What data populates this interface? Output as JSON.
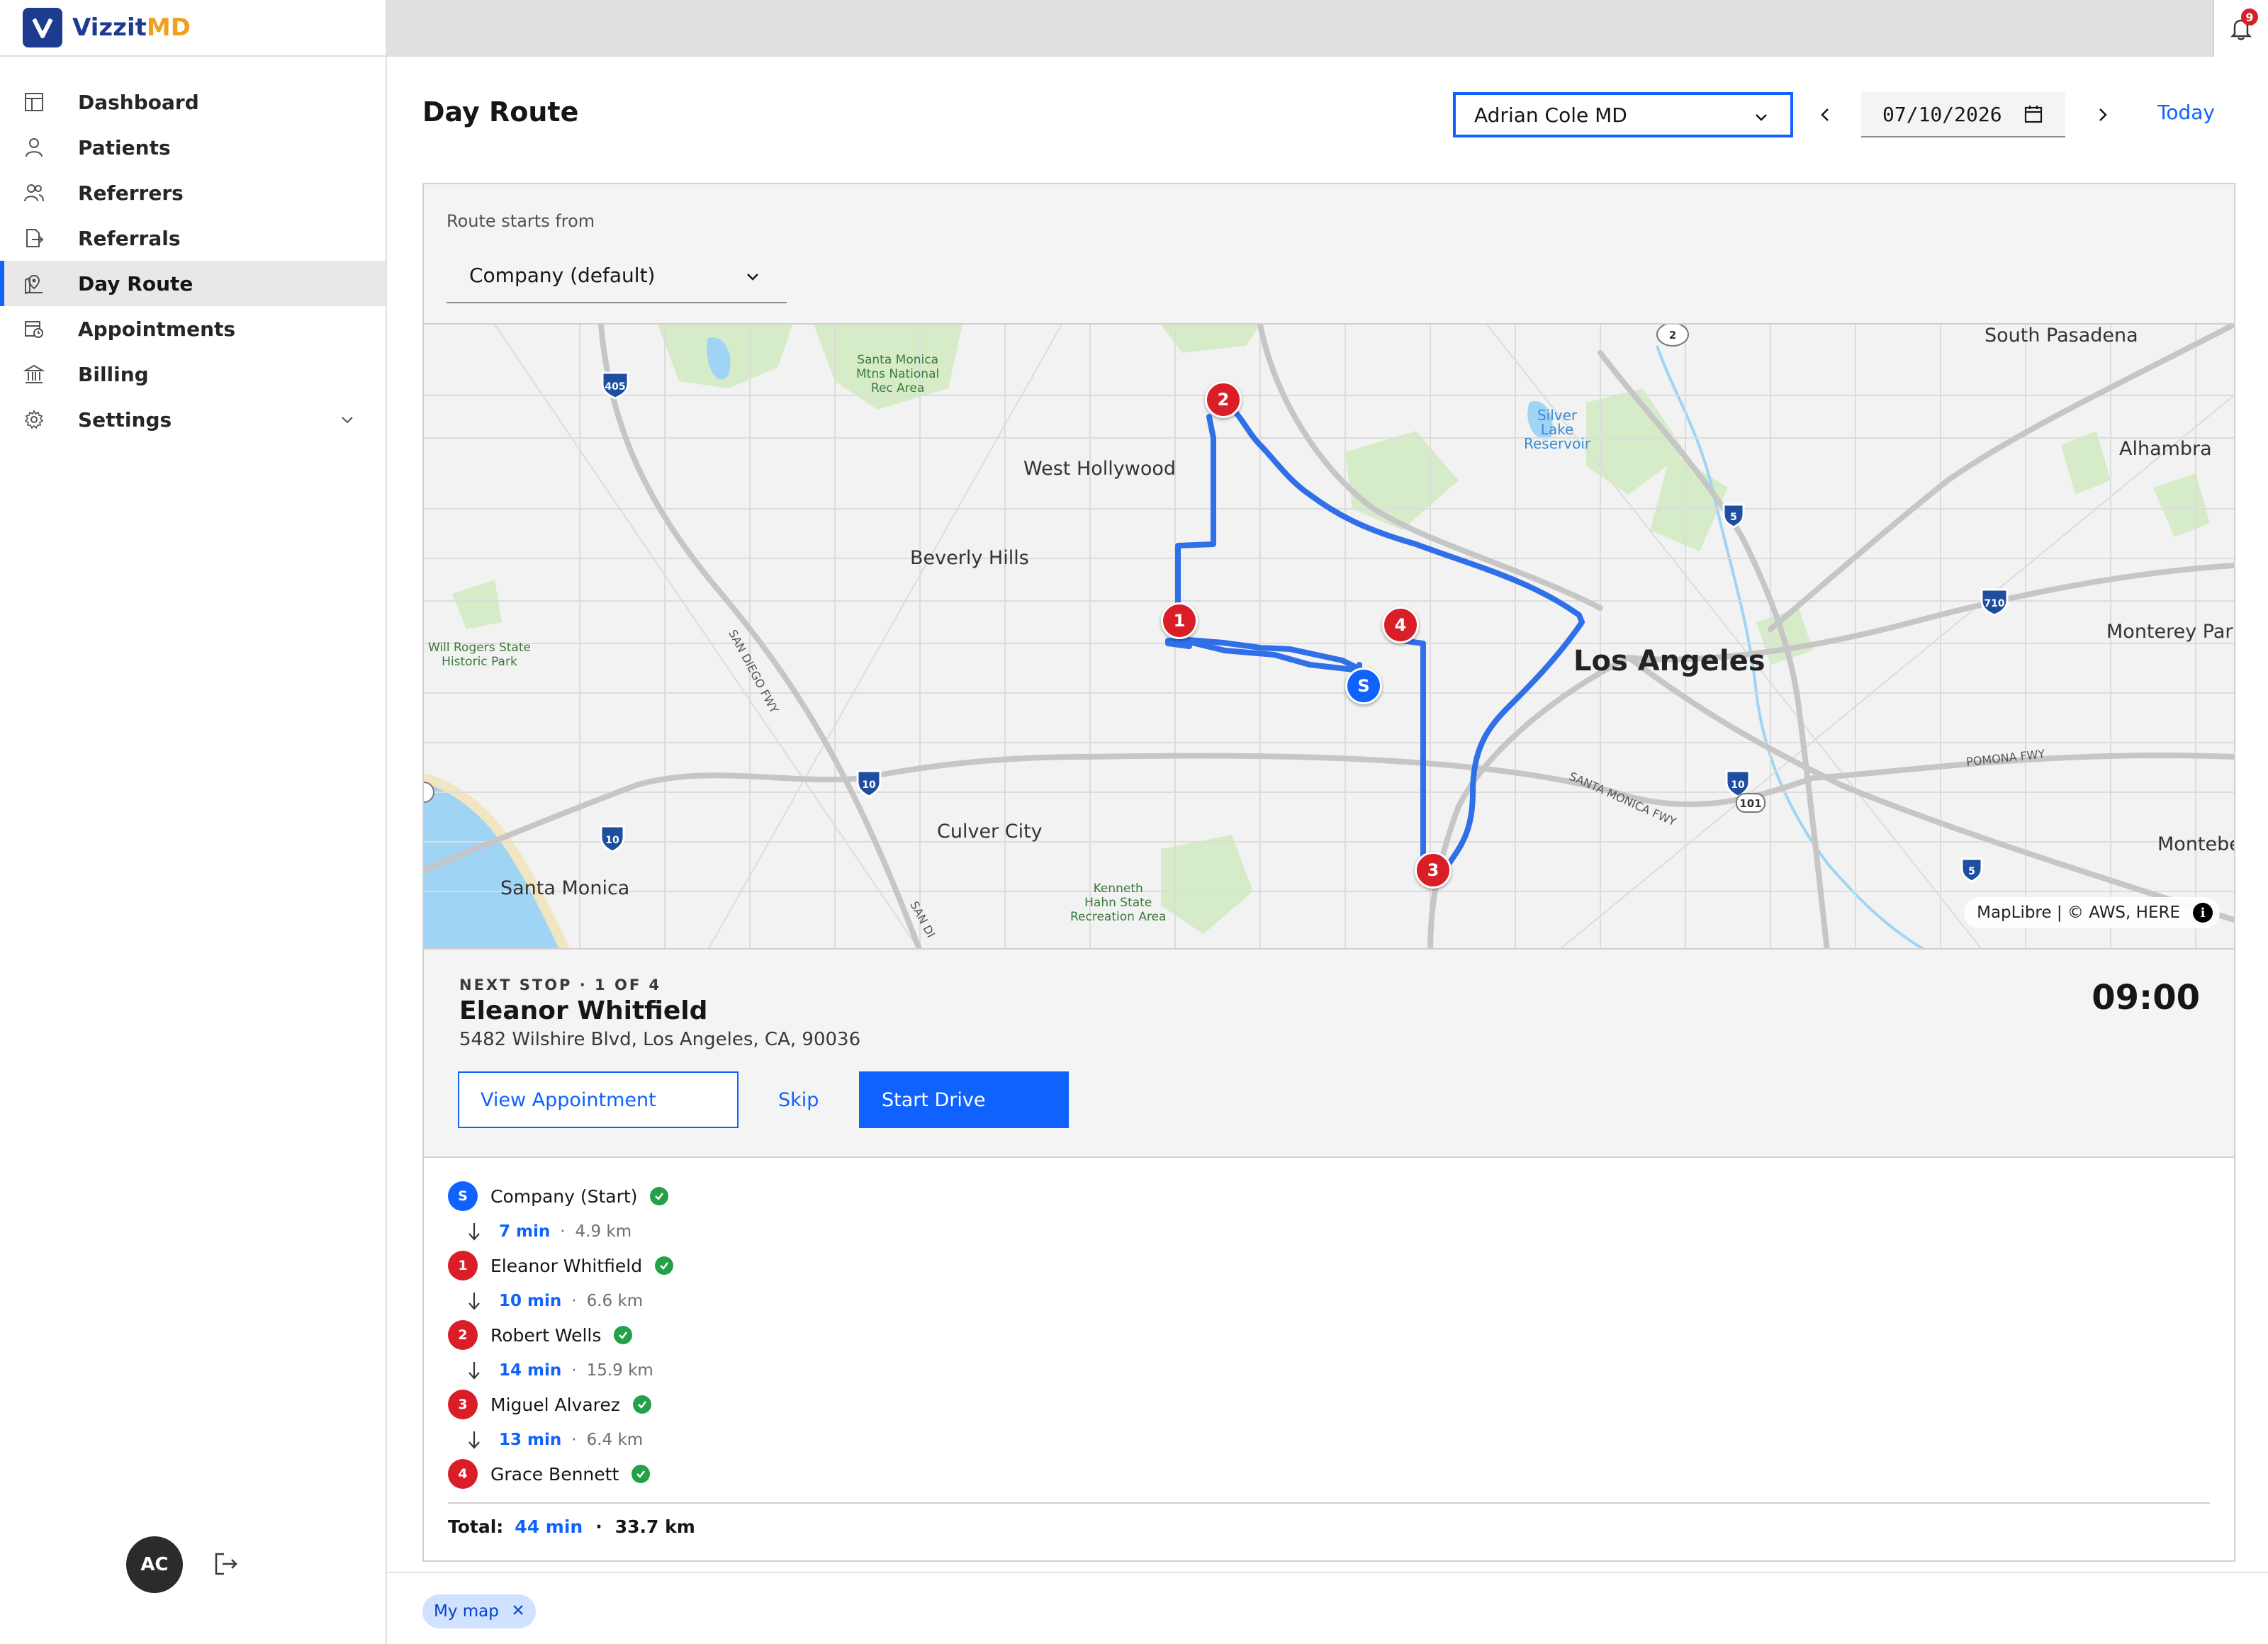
{
  "brand": {
    "name_a": "Vizzit",
    "name_b": "MD"
  },
  "notifications": {
    "count": "9"
  },
  "sidebar": {
    "items": [
      {
        "label": "Dashboard",
        "icon": "dashboard-icon"
      },
      {
        "label": "Patients",
        "icon": "user-icon"
      },
      {
        "label": "Referrers",
        "icon": "users-icon"
      },
      {
        "label": "Referrals",
        "icon": "document-export-icon"
      },
      {
        "label": "Day Route",
        "icon": "map-pin-icon",
        "active": true
      },
      {
        "label": "Appointments",
        "icon": "calendar-clock-icon"
      },
      {
        "label": "Billing",
        "icon": "bank-icon"
      },
      {
        "label": "Settings",
        "icon": "gear-icon"
      }
    ],
    "user_initials": "AC"
  },
  "header": {
    "title": "Day Route",
    "doctor": "Adrian Cole MD",
    "date": "07/10/2026",
    "today_label": "Today"
  },
  "route": {
    "starts_from_label": "Route starts from",
    "starts_from_value": "Company (default)"
  },
  "map": {
    "labels": {
      "south_pasadena": "South Pasadena",
      "alhambra": "Alhambra",
      "monterey_park": "Monterey Park",
      "montebello": "Montebe",
      "west_hollywood": "West Hollywood",
      "beverly_hills": "Beverly Hills",
      "los_angeles": "Los Angeles",
      "culver_city": "Culver City",
      "santa_monica": "Santa Monica",
      "santa_monica_mtns": "Santa Monica\nMtns National\nRec Area",
      "will_rogers": "Will Rogers State\nHistoric Park",
      "kenneth_hahn": "Kenneth\nHahn State\nRecreation Area",
      "silver_lake": "Silver\nLake\nReservoir",
      "san_diego_fwy": "SAN DIEGO FWY",
      "santa_monica_fwy": "SANTA MONICA FWY",
      "pomona_fwy": "POMONA FWY",
      "san_d2": "SAN DI"
    },
    "shields": [
      "405",
      "10",
      "10",
      "10",
      "5",
      "5",
      "710",
      "101",
      "2"
    ],
    "pins": [
      {
        "label": "S",
        "kind": "start"
      },
      {
        "label": "1",
        "kind": "stop"
      },
      {
        "label": "2",
        "kind": "stop"
      },
      {
        "label": "3",
        "kind": "stop"
      },
      {
        "label": "4",
        "kind": "stop"
      }
    ],
    "attribution": "MapLibre | © AWS, HERE",
    "route_color": "#2f6fe8"
  },
  "next_stop": {
    "kicker": "NEXT STOP · 1 OF 4",
    "name": "Eleanor Whitfield",
    "address": "5482 Wilshire Blvd, Los Angeles, CA, 90036",
    "time": "09:00",
    "view_label": "View Appointment",
    "skip_label": "Skip",
    "start_label": "Start Drive"
  },
  "stops": [
    {
      "badge": "S",
      "name": "Company (Start)"
    },
    {
      "badge": "1",
      "name": "Eleanor Whitfield"
    },
    {
      "badge": "2",
      "name": "Robert Wells"
    },
    {
      "badge": "3",
      "name": "Miguel Alvarez"
    },
    {
      "badge": "4",
      "name": "Grace Bennett"
    }
  ],
  "legs": [
    {
      "min": "7 min",
      "km": "4.9 km"
    },
    {
      "min": "10 min",
      "km": "6.6 km"
    },
    {
      "min": "14 min",
      "km": "15.9 km"
    },
    {
      "min": "13 min",
      "km": "6.4 km"
    }
  ],
  "totals": {
    "label": "Total:",
    "min": "44 min",
    "km": "33.7 km",
    "sep": "·"
  },
  "chip": {
    "label": "My map"
  },
  "colors": {
    "accent": "#0f62fe",
    "stop_red": "#da1e28",
    "done_green": "#24a148",
    "brand_navy": "#1d3b8f",
    "brand_orange": "#f0a020"
  }
}
